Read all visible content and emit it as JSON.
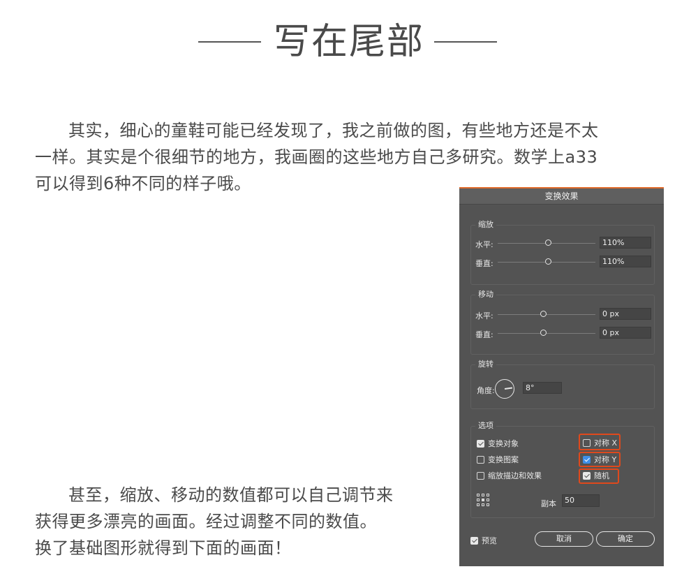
{
  "heading": {
    "title": "写在尾部"
  },
  "article": {
    "para1": [
      "其实，细心的童鞋可能已经发现了，我之前做的图，有些地方还是不太",
      "一样。其实是个很细节的地方，我画圈的这些地方自己多研究。数学上a33",
      "可以得到6种不同的样子哦。"
    ],
    "para2": [
      "甚至，缩放、移动的数值都可以自己调节来",
      "获得更多漂亮的画面。经过调整不同的数值。",
      "换了基础图形就得到下面的画面！"
    ]
  },
  "dialog": {
    "title": "变换效果",
    "scale": {
      "label": "缩放",
      "horizontal": {
        "label": "水平:",
        "value": "110%",
        "slider": 0.52
      },
      "vertical": {
        "label": "垂直:",
        "value": "110%",
        "slider": 0.52
      }
    },
    "move": {
      "label": "移动",
      "horizontal": {
        "label": "水平:",
        "value": "0 px",
        "slider": 0.47
      },
      "vertical": {
        "label": "垂直:",
        "value": "0 px",
        "slider": 0.47
      }
    },
    "rotate": {
      "label": "旋转",
      "angle_label": "角度:",
      "angle_value": "8°"
    },
    "options": {
      "label": "选项",
      "transform_objects": {
        "label": "变换对象",
        "checked": true
      },
      "transform_patterns": {
        "label": "变换图案",
        "checked": false
      },
      "scale_strokes": {
        "label": "缩放描边和效果",
        "checked": false
      },
      "reflect_x": {
        "label": "对称 X",
        "checked": false
      },
      "reflect_y": {
        "label": "对称 Y",
        "checked": true
      },
      "random": {
        "label": "随机",
        "checked": true
      },
      "copies_label": "副本",
      "copies_value": "50"
    },
    "preview": {
      "label": "预览",
      "checked": true
    },
    "cancel_label": "取消",
    "ok_label": "确定",
    "highlight_color": "#e0491c",
    "accent_color": "#3f8fe8"
  }
}
